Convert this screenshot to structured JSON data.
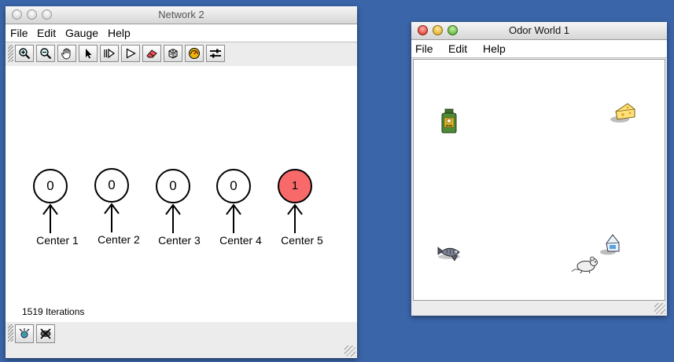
{
  "network_window": {
    "title": "Network 2",
    "menu": [
      "File",
      "Edit",
      "Gauge",
      "Help"
    ],
    "toolbar": [
      "zoom-in-icon",
      "zoom-out-icon",
      "pan-hand-icon",
      "selection-arrow-icon",
      "step-icon",
      "play-icon",
      "eraser-icon",
      "randomize-icon",
      "gauge-icon",
      "update-sliders-icon"
    ],
    "neurons": [
      {
        "value": "0",
        "label": "Center 1",
        "active": false
      },
      {
        "value": "0",
        "label": "Center 2",
        "active": false
      },
      {
        "value": "0",
        "label": "Center 3",
        "active": false
      },
      {
        "value": "0",
        "label": "Center 4",
        "active": false
      },
      {
        "value": "1",
        "label": "Center 5",
        "active": true
      }
    ],
    "status": "1519 Iterations",
    "bottom_tools": [
      "world-link-icon",
      "clear-world-icon"
    ],
    "active_color": "#f86a6a"
  },
  "odor_window": {
    "title": "Odor World 1",
    "menu": [
      "File",
      "Edit",
      "Help"
    ],
    "entities": [
      "poison-bottle-icon",
      "cheese-icon",
      "fish-icon",
      "milk-carton-icon",
      "mouse-icon"
    ]
  }
}
